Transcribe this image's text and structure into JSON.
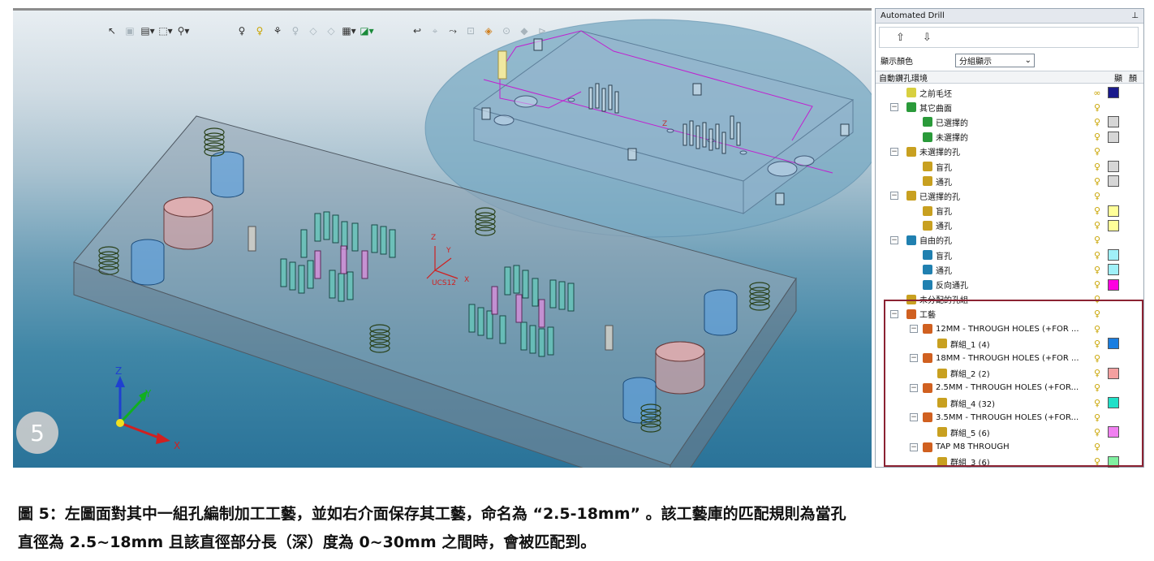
{
  "figure_badge": "5",
  "toolbar_icons": {
    "group1": [
      "select-x-icon",
      "view-box-icon",
      "view-menu-icon",
      "box-select-icon",
      "filter-icon"
    ],
    "group2": [
      "bulb-icon",
      "bulb-on-icon",
      "multi-bulb-icon",
      "bulb-off-icon",
      "arrow-left-icon",
      "arrow-right-icon",
      "layer-icon",
      "export-icon"
    ],
    "group3": [
      "undo-icon",
      "faint-tool-1-icon",
      "path-icon",
      "faint-tool-2-icon",
      "highlight-tool-icon",
      "faint-tool-3-icon",
      "faint-tool-4-icon",
      "faint-tool-5-icon"
    ]
  },
  "viewport": {
    "ucs_label": "UCS12",
    "axis_x": "X",
    "axis_y": "Y",
    "axis_z": "Z",
    "corner_axis_x": "X",
    "corner_axis_y": "Y",
    "corner_axis_z": "Z"
  },
  "panel": {
    "title": "Automated Drill",
    "pin": "p",
    "up_arrow": "⇧",
    "down_arrow": "⇩",
    "display_color_label": "顯示顏色",
    "display_color_value": "分組顯示",
    "header_label": "自動鑽孔環境",
    "header_col_show": "顯",
    "header_col_color": "顏",
    "rows": [
      {
        "text": "之前毛坯",
        "level": 0,
        "toggle": "",
        "icon": "#d8d040",
        "bulb": "∞",
        "color": "#1a1a8c"
      },
      {
        "text": "其它曲面",
        "level": 0,
        "toggle": "−",
        "icon": "#2a9a3a",
        "bulb": "♀",
        "color": ""
      },
      {
        "text": "已選擇的",
        "level": 1,
        "toggle": "",
        "icon": "#2a9a3a",
        "bulb": "♀",
        "color": "#d6d6d6"
      },
      {
        "text": "未選擇的",
        "level": 1,
        "toggle": "",
        "icon": "#2a9a3a",
        "bulb": "♀",
        "color": "#d6d6d6"
      },
      {
        "text": "未選擇的孔",
        "level": 0,
        "toggle": "−",
        "icon": "#c8a020",
        "bulb": "♀",
        "color": ""
      },
      {
        "text": "盲孔",
        "level": 1,
        "toggle": "",
        "icon": "#c8a020",
        "bulb": "♀",
        "color": "#d6d6d6"
      },
      {
        "text": "通孔",
        "level": 1,
        "toggle": "",
        "icon": "#c8a020",
        "bulb": "♀",
        "color": "#d6d6d6"
      },
      {
        "text": "已選擇的孔",
        "level": 0,
        "toggle": "−",
        "icon": "#c8a020",
        "bulb": "♀",
        "color": ""
      },
      {
        "text": "盲孔",
        "level": 1,
        "toggle": "",
        "icon": "#c8a020",
        "bulb": "♀",
        "color": "#ffff99"
      },
      {
        "text": "通孔",
        "level": 1,
        "toggle": "",
        "icon": "#c8a020",
        "bulb": "♀",
        "color": "#ffff99"
      },
      {
        "text": "自由的孔",
        "level": 0,
        "toggle": "−",
        "icon": "#2080b0",
        "bulb": "♀",
        "color": ""
      },
      {
        "text": "盲孔",
        "level": 1,
        "toggle": "",
        "icon": "#2080b0",
        "bulb": "♀",
        "color": "#a0f0f8"
      },
      {
        "text": "通孔",
        "level": 1,
        "toggle": "",
        "icon": "#2080b0",
        "bulb": "♀",
        "color": "#a0f0f8"
      },
      {
        "text": "反向通孔",
        "level": 1,
        "toggle": "",
        "icon": "#2080b0",
        "bulb": "♀",
        "color": "#ff00e0"
      },
      {
        "text": "未分配的孔組",
        "level": 0,
        "toggle": "",
        "icon": "#c8a020",
        "bulb": "♀",
        "color": ""
      },
      {
        "text": "工藝",
        "level": 0,
        "toggle": "−",
        "icon": "#d06020",
        "bulb": "♀",
        "color": ""
      },
      {
        "text": "12MM - THROUGH HOLES (+FOR ...",
        "level": 1,
        "toggle": "−",
        "icon": "#d06020",
        "bulb": "♀",
        "color": ""
      },
      {
        "text": "群組_1 (4)",
        "level": 2,
        "toggle": "",
        "icon": "#c8a020",
        "bulb": "♀",
        "color": "#1a7ee0"
      },
      {
        "text": "18MM - THROUGH HOLES (+FOR ...",
        "level": 1,
        "toggle": "−",
        "icon": "#d06020",
        "bulb": "♀",
        "color": ""
      },
      {
        "text": "群組_2 (2)",
        "level": 2,
        "toggle": "",
        "icon": "#c8a020",
        "bulb": "♀",
        "color": "#f4a0a0"
      },
      {
        "text": "2.5MM - THROUGH HOLES (+FOR...",
        "level": 1,
        "toggle": "−",
        "icon": "#d06020",
        "bulb": "♀",
        "color": ""
      },
      {
        "text": "群組_4 (32)",
        "level": 2,
        "toggle": "",
        "icon": "#c8a020",
        "bulb": "♀",
        "color": "#20e0c8"
      },
      {
        "text": "3.5MM - THROUGH HOLES (+FOR...",
        "level": 1,
        "toggle": "−",
        "icon": "#d06020",
        "bulb": "♀",
        "color": ""
      },
      {
        "text": "群組_5 (6)",
        "level": 2,
        "toggle": "",
        "icon": "#c8a020",
        "bulb": "♀",
        "color": "#f080f0"
      },
      {
        "text": "TAP M8 THROUGH",
        "level": 1,
        "toggle": "−",
        "icon": "#d06020",
        "bulb": "♀",
        "color": ""
      },
      {
        "text": "群組_3 (6)",
        "level": 2,
        "toggle": "",
        "icon": "#c8a020",
        "bulb": "♀",
        "color": "#80f0a0"
      }
    ]
  },
  "caption": {
    "line1": "圖 5：左圖面對其中一組孔編制加工工藝，並如右介面保存其工藝，命名為 “2.5-18mm” 。該工藝庫的匹配規則為當孔",
    "line2": "直徑為 2.5~18mm 且該直徑部分長（深）度為 0~30mm 之間時，會被匹配到。"
  }
}
